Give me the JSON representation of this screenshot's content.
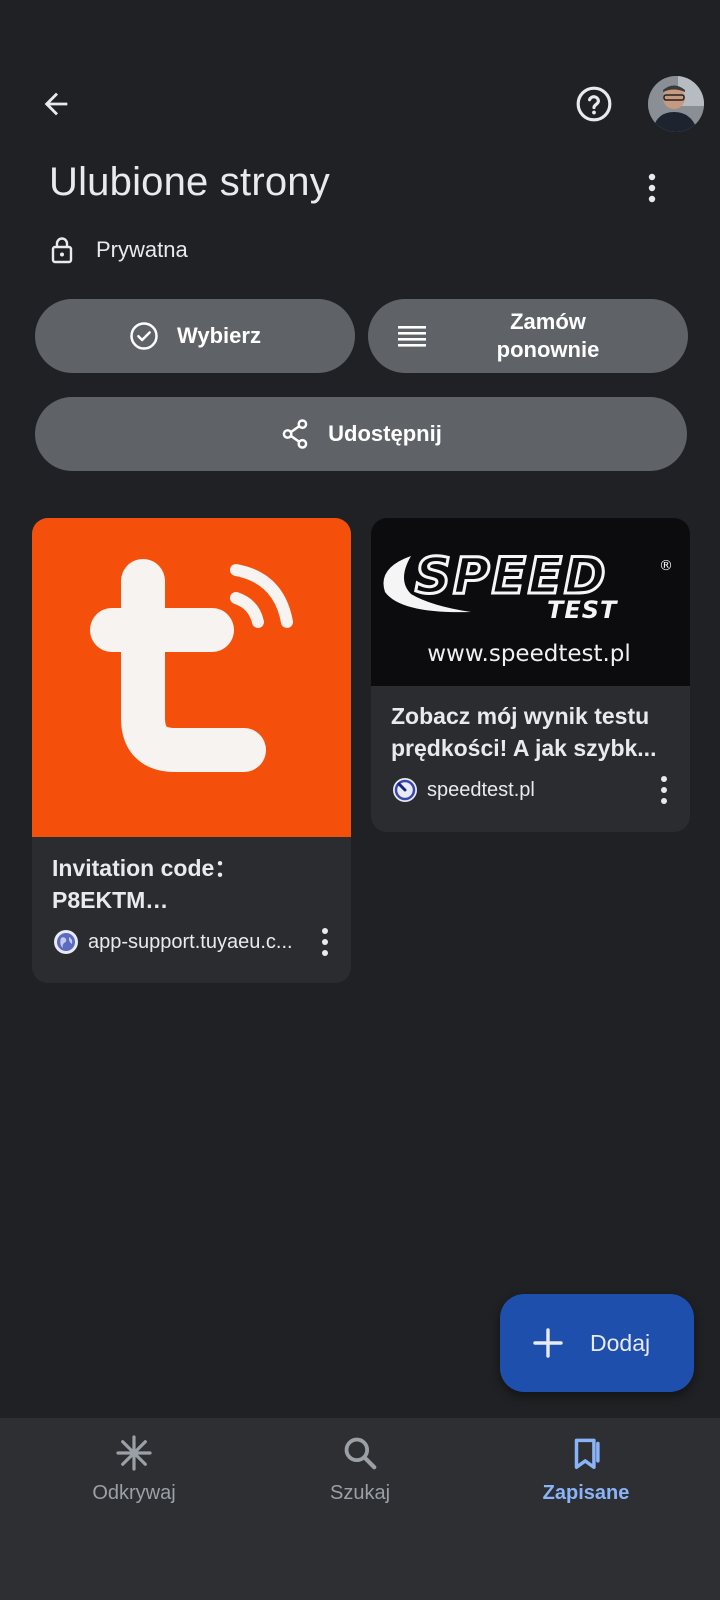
{
  "header": {
    "back_icon": "arrow-back-icon",
    "help_icon": "help-circle-icon",
    "title": "Ulubione strony",
    "more_icon": "more-vert-icon"
  },
  "privacy": {
    "icon": "lock-icon",
    "label": "Prywatna"
  },
  "actions": {
    "select_label": "Wybierz",
    "reorder_label_line1": "Zamów",
    "reorder_label_line2": "ponownie",
    "share_label": "Udostępnij"
  },
  "cards": [
    {
      "title_line1": "Invitation code：",
      "title_line2": "P8EKTM…",
      "source": "app-support.tuyaeu.c...",
      "thumb_color": "#f4500c"
    },
    {
      "title_line1": "Zobacz mój wynik testu",
      "title_line2": "prędkości! A jak szybk...",
      "source": "speedtest.pl",
      "thumb_logo_line1": "SPEED",
      "thumb_logo_line2": "TEST",
      "thumb_url": "www.speedtest.pl",
      "thumb_registered": "®"
    }
  ],
  "fab": {
    "icon": "plus-icon",
    "label": "Dodaj"
  },
  "bottom_nav": [
    {
      "label": "Odkrywaj",
      "icon": "asterisk-icon",
      "active": false
    },
    {
      "label": "Szukaj",
      "icon": "search-icon",
      "active": false
    },
    {
      "label": "Zapisane",
      "icon": "bookmarks-icon",
      "active": true
    }
  ],
  "colors": {
    "background": "#202124",
    "pill": "#5f6368",
    "card": "#2b2c2f",
    "fab": "#1f4fac",
    "accent": "#8ab4f8",
    "nav_bg": "#2e2f33"
  }
}
